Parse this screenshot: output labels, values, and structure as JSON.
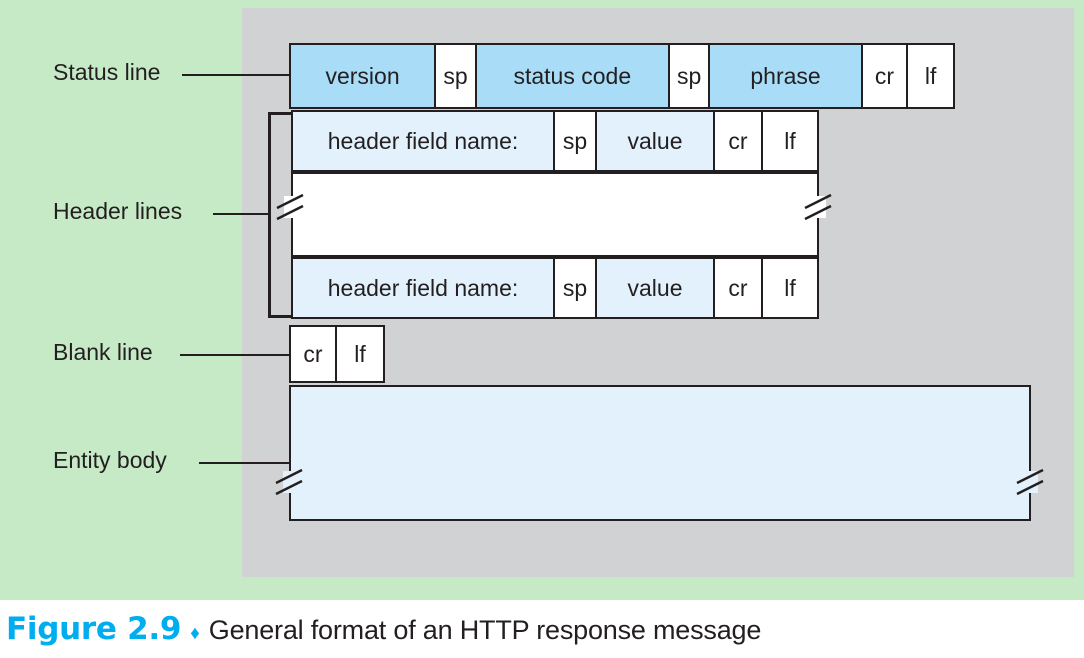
{
  "figure": {
    "number": "Figure 2.9",
    "separator": "♦",
    "caption": "General format of an HTTP response message"
  },
  "colors": {
    "page_background": "#c6e9c6",
    "panel_background": "#d1d2d4",
    "field_strong": "#a8dcf7",
    "field_light": "#e2f1fb",
    "cell_white": "#ffffff",
    "stroke": "#231f20",
    "figure_number": "#00aeef",
    "caption_background": "#ffffff"
  },
  "labels": {
    "status_line": "Status line",
    "header_lines": "Header lines",
    "blank_line": "Blank line",
    "entity_body": "Entity body"
  },
  "diagram": {
    "title": "General format of an HTTP response message",
    "rows": [
      {
        "id": "status-line",
        "label": "Status line",
        "cells": [
          {
            "text": "version",
            "fill": "strong"
          },
          {
            "text": "sp",
            "fill": "white"
          },
          {
            "text": "status code",
            "fill": "strong"
          },
          {
            "text": "sp",
            "fill": "white"
          },
          {
            "text": "phrase",
            "fill": "strong"
          },
          {
            "text": "cr",
            "fill": "white"
          },
          {
            "text": "lf",
            "fill": "white"
          }
        ]
      },
      {
        "id": "header-line-first",
        "label": "Header lines",
        "cells": [
          {
            "text": "header field name:",
            "fill": "light"
          },
          {
            "text": "sp",
            "fill": "white"
          },
          {
            "text": "value",
            "fill": "light"
          },
          {
            "text": "cr",
            "fill": "white"
          },
          {
            "text": "lf",
            "fill": "white"
          }
        ]
      },
      {
        "id": "header-lines-gap",
        "label": "Header lines continuation",
        "cells": [
          {
            "text": "",
            "fill": "white"
          }
        ]
      },
      {
        "id": "header-line-last",
        "label": "Header lines",
        "cells": [
          {
            "text": "header field name:",
            "fill": "light"
          },
          {
            "text": "sp",
            "fill": "white"
          },
          {
            "text": "value",
            "fill": "light"
          },
          {
            "text": "cr",
            "fill": "white"
          },
          {
            "text": "lf",
            "fill": "white"
          }
        ]
      },
      {
        "id": "blank-line",
        "label": "Blank line",
        "cells": [
          {
            "text": "cr",
            "fill": "white"
          },
          {
            "text": "lf",
            "fill": "white"
          }
        ]
      },
      {
        "id": "entity-body",
        "label": "Entity body",
        "cells": [
          {
            "text": "",
            "fill": "light"
          }
        ]
      }
    ]
  }
}
